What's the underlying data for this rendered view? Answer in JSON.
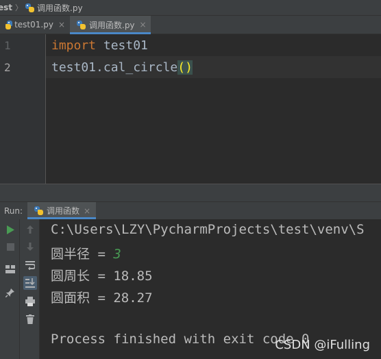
{
  "nav": {
    "project": "est",
    "file": "调用函数.py"
  },
  "tabs": [
    {
      "label": "test01.py",
      "close": "×",
      "active": false
    },
    {
      "label": "调用函数.py",
      "close": "×",
      "active": true
    }
  ],
  "editor": {
    "lines": [
      {
        "number": "1",
        "keyword": "import",
        "rest": " test01"
      },
      {
        "number": "2",
        "prefix": "test01.cal_circle",
        "parens": "()"
      }
    ]
  },
  "run": {
    "label": "Run:",
    "tab_label": "调用函数",
    "close": "×"
  },
  "console": {
    "path": "C:\\Users\\LZY\\PycharmProjects\\test\\venv\\S",
    "radius_label": "圆半径 = ",
    "radius_value": "3",
    "perimeter": "圆周长 = 18.85",
    "area": "圆面积 = 28.27",
    "finished": "Process finished with exit code 0"
  },
  "watermark": "CSDN @iFulling",
  "colors": {
    "keyword": "#cc7832",
    "code": "#a9b7c6",
    "accent": "#4a88c7",
    "run_green": "#499c54"
  }
}
